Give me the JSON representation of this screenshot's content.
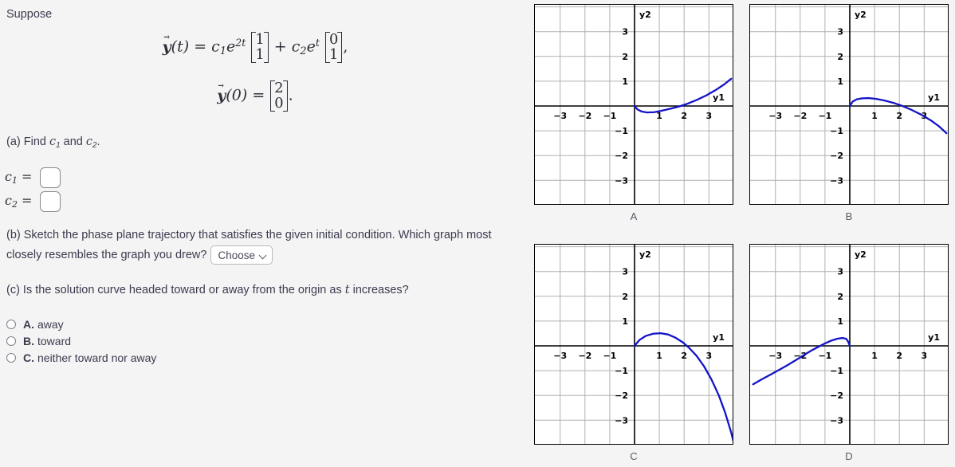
{
  "problem": {
    "intro": "Suppose",
    "equation_1": {
      "lhs_vec": "y",
      "lhs_arg": "(t)",
      "eq": "=",
      "term1_coef": "c",
      "term1_sub": "1",
      "term1_exp_base": "e",
      "term1_exp": "2t",
      "term1_matrix": [
        "1",
        "1"
      ],
      "plus": "+",
      "term2_coef": "c",
      "term2_sub": "2",
      "term2_exp_base": "e",
      "term2_exp": "t",
      "term2_matrix": [
        "0",
        "1"
      ],
      "trailing": ","
    },
    "equation_2": {
      "lhs_vec": "y",
      "lhs_arg": "(0)",
      "eq": "=",
      "matrix": [
        "2",
        "0"
      ],
      "trailing": "."
    }
  },
  "part_a": {
    "prompt_prefix": "(a) Find ",
    "prompt_c1": "c",
    "prompt_c1_sub": "1",
    "prompt_and": " and ",
    "prompt_c2": "c",
    "prompt_c2_sub": "2",
    "prompt_suffix": ".",
    "fields": [
      {
        "label_base": "c",
        "label_sub": "1",
        "eq": "=",
        "value": "",
        "placeholder": ""
      },
      {
        "label_base": "c",
        "label_sub": "2",
        "eq": "=",
        "value": "",
        "placeholder": ""
      }
    ]
  },
  "part_b": {
    "text_line1": "(b) Sketch the phase plane trajectory that satisfies the given initial condition. Which graph most closely",
    "text_line2": "resembles the graph you drew?",
    "dropdown": {
      "selected": "Choose",
      "options": [
        "Choose",
        "A",
        "B",
        "C",
        "D"
      ],
      "chevron_icon": "chevron-down-icon"
    }
  },
  "part_c": {
    "text_prefix": "(c) Is the solution curve headed toward or away from the origin as ",
    "text_var": "t",
    "text_suffix": " increases?",
    "options": [
      {
        "letter": "A.",
        "label": "away",
        "selected": false
      },
      {
        "letter": "B.",
        "label": "toward",
        "selected": false
      },
      {
        "letter": "C.",
        "label": "neither toward nor away",
        "selected": false
      }
    ]
  },
  "graphs": {
    "axis_label_x": "y1",
    "axis_label_y": "y2",
    "x_ticks": [
      -3,
      -2,
      -1,
      1,
      2,
      3
    ],
    "y_ticks": [
      3,
      2,
      1,
      -1,
      -2,
      -3
    ],
    "curve_color": "#1414c8",
    "grid_color": "#b0b0b0",
    "axis_color": "#000000",
    "panels": [
      {
        "caption": "A",
        "name": "graph-panel-a"
      },
      {
        "caption": "B",
        "name": "graph-panel-b"
      },
      {
        "caption": "C",
        "name": "graph-panel-c"
      },
      {
        "caption": "D",
        "name": "graph-panel-d"
      }
    ]
  },
  "chart_data": [
    {
      "type": "line",
      "title": "A",
      "xlabel": "y1",
      "ylabel": "y2",
      "xlim": [
        -3.9,
        3.9
      ],
      "ylim": [
        -3.9,
        3.9
      ],
      "grid": true,
      "legend": null,
      "series": [
        {
          "name": "trajectory-A",
          "color": "#1414c8",
          "points": [
            [
              0.0,
              0.0
            ],
            [
              0.12,
              -0.14
            ],
            [
              0.28,
              -0.22
            ],
            [
              0.5,
              -0.26
            ],
            [
              0.8,
              -0.25
            ],
            [
              1.1,
              -0.19
            ],
            [
              1.45,
              -0.11
            ],
            [
              1.8,
              -0.02
            ],
            [
              2.1,
              0.08
            ],
            [
              2.5,
              0.24
            ],
            [
              2.9,
              0.43
            ],
            [
              3.3,
              0.66
            ],
            [
              3.6,
              0.86
            ],
            [
              3.9,
              1.1
            ]
          ]
        }
      ]
    },
    {
      "type": "line",
      "title": "B",
      "xlabel": "y1",
      "ylabel": "y2",
      "xlim": [
        -3.9,
        3.9
      ],
      "ylim": [
        -3.9,
        3.9
      ],
      "grid": true,
      "legend": null,
      "series": [
        {
          "name": "trajectory-B",
          "color": "#1414c8",
          "points": [
            [
              0.0,
              0.0
            ],
            [
              0.12,
              0.18
            ],
            [
              0.28,
              0.27
            ],
            [
              0.5,
              0.31
            ],
            [
              0.75,
              0.32
            ],
            [
              1.05,
              0.29
            ],
            [
              1.4,
              0.22
            ],
            [
              1.75,
              0.13
            ],
            [
              2.1,
              0.01
            ],
            [
              2.5,
              -0.16
            ],
            [
              2.9,
              -0.36
            ],
            [
              3.3,
              -0.6
            ],
            [
              3.6,
              -0.82
            ],
            [
              3.9,
              -1.1
            ]
          ]
        }
      ]
    },
    {
      "type": "line",
      "title": "C",
      "xlabel": "y1",
      "ylabel": "y2",
      "xlim": [
        -3.9,
        3.9
      ],
      "ylim": [
        -3.9,
        3.9
      ],
      "grid": true,
      "legend": null,
      "series": [
        {
          "name": "trajectory-C",
          "color": "#1414c8",
          "points": [
            [
              0.0,
              0.0
            ],
            [
              0.2,
              0.24
            ],
            [
              0.45,
              0.4
            ],
            [
              0.75,
              0.49
            ],
            [
              1.05,
              0.51
            ],
            [
              1.35,
              0.46
            ],
            [
              1.65,
              0.33
            ],
            [
              1.95,
              0.14
            ],
            [
              2.2,
              -0.08
            ],
            [
              2.5,
              -0.4
            ],
            [
              2.8,
              -0.82
            ],
            [
              3.1,
              -1.35
            ],
            [
              3.4,
              -2.0
            ],
            [
              3.65,
              -2.68
            ],
            [
              3.9,
              -3.5
            ],
            [
              4.0,
              -3.9
            ]
          ]
        }
      ]
    },
    {
      "type": "line",
      "title": "D",
      "xlabel": "y1",
      "ylabel": "y2",
      "xlim": [
        -3.9,
        3.9
      ],
      "ylim": [
        -3.9,
        3.9
      ],
      "grid": true,
      "legend": null,
      "series": [
        {
          "name": "trajectory-D",
          "color": "#1414c8",
          "points": [
            [
              -3.9,
              -1.55
            ],
            [
              -3.55,
              -1.35
            ],
            [
              -3.2,
              -1.16
            ],
            [
              -2.85,
              -0.97
            ],
            [
              -2.5,
              -0.77
            ],
            [
              -2.15,
              -0.56
            ],
            [
              -1.85,
              -0.37
            ],
            [
              -1.55,
              -0.19
            ],
            [
              -1.25,
              -0.03
            ],
            [
              -1.0,
              0.1
            ],
            [
              -0.75,
              0.21
            ],
            [
              -0.5,
              0.29
            ],
            [
              -0.28,
              0.32
            ],
            [
              -0.14,
              0.28
            ],
            [
              -0.06,
              0.16
            ],
            [
              0.0,
              0.0
            ]
          ]
        }
      ]
    }
  ]
}
